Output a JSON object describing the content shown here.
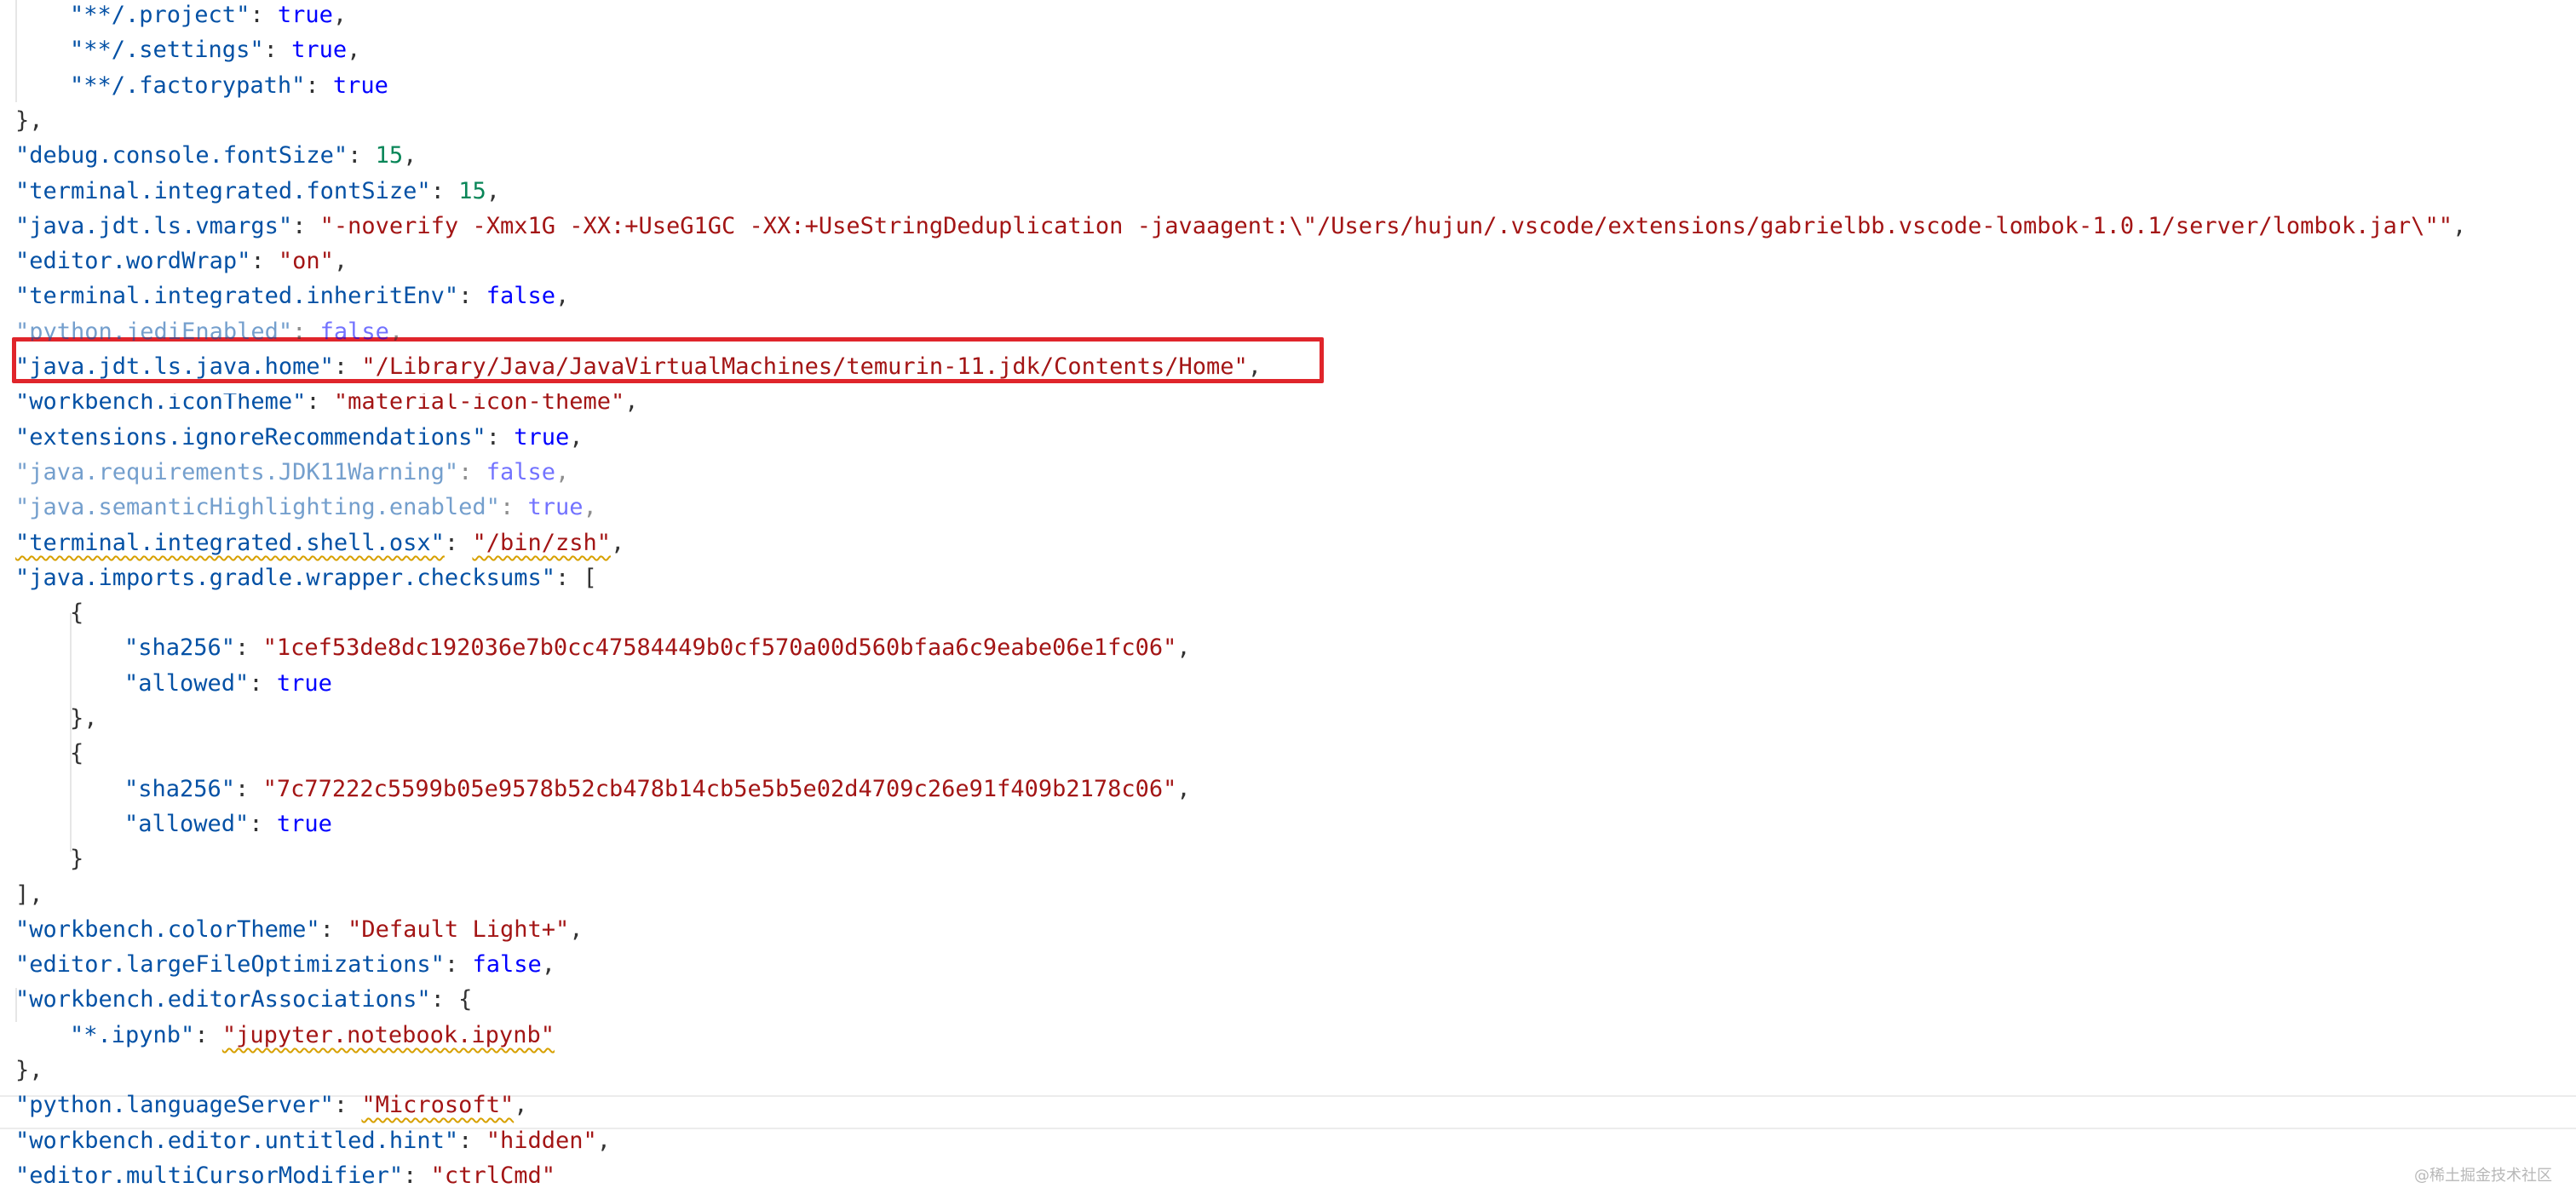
{
  "lines": [
    {
      "parts": [
        {
          "t": "\"**/.project\"",
          "c": "key"
        },
        {
          "t": ": ",
          "c": "punc"
        },
        {
          "t": "true",
          "c": "bool"
        },
        {
          "t": ",",
          "c": "punc"
        }
      ]
    },
    {
      "parts": [
        {
          "t": "\"**/.settings\"",
          "c": "key"
        },
        {
          "t": ": ",
          "c": "punc"
        },
        {
          "t": "true",
          "c": "bool"
        },
        {
          "t": ",",
          "c": "punc"
        }
      ]
    },
    {
      "parts": [
        {
          "t": "\"**/.factorypath\"",
          "c": "key"
        },
        {
          "t": ": ",
          "c": "punc"
        },
        {
          "t": "true",
          "c": "bool"
        }
      ]
    },
    {
      "parts": [
        {
          "t": "},",
          "c": "punc"
        }
      ]
    },
    {
      "parts": [
        {
          "t": "\"debug.console.fontSize\"",
          "c": "key"
        },
        {
          "t": ": ",
          "c": "punc"
        },
        {
          "t": "15",
          "c": "num"
        },
        {
          "t": ",",
          "c": "punc"
        }
      ]
    },
    {
      "parts": [
        {
          "t": "\"terminal.integrated.fontSize\"",
          "c": "key"
        },
        {
          "t": ": ",
          "c": "punc"
        },
        {
          "t": "15",
          "c": "num"
        },
        {
          "t": ",",
          "c": "punc"
        }
      ]
    },
    {
      "parts": [
        {
          "t": "\"java.jdt.ls.vmargs\"",
          "c": "key"
        },
        {
          "t": ": ",
          "c": "punc"
        },
        {
          "t": "\"-noverify -Xmx1G -XX:+UseG1GC -XX:+UseStringDeduplication -javaagent:\\\"/Users/hujun/.vscode/extensions/gabrielbb.vscode-lombok-1.0.1/server/lombok.jar\\\"\"",
          "c": "str"
        },
        {
          "t": ",",
          "c": "punc"
        }
      ]
    },
    {
      "parts": [
        {
          "t": "\"editor.wordWrap\"",
          "c": "key"
        },
        {
          "t": ": ",
          "c": "punc"
        },
        {
          "t": "\"on\"",
          "c": "str"
        },
        {
          "t": ",",
          "c": "punc"
        }
      ]
    },
    {
      "parts": [
        {
          "t": "\"terminal.integrated.inheritEnv\"",
          "c": "key"
        },
        {
          "t": ": ",
          "c": "punc"
        },
        {
          "t": "false",
          "c": "bool"
        },
        {
          "t": ",",
          "c": "punc"
        }
      ]
    },
    {
      "parts": [
        {
          "t": "\"python.jediEnabled\"",
          "c": "key"
        },
        {
          "t": ": ",
          "c": "punc"
        },
        {
          "t": "false",
          "c": "bool"
        },
        {
          "t": ",",
          "c": "punc"
        }
      ]
    },
    {
      "parts": [
        {
          "t": "\"java.jdt.ls.java.home\"",
          "c": "key"
        },
        {
          "t": ": ",
          "c": "punc"
        },
        {
          "t": "\"/Library/Java/JavaVirtualMachines/temurin-11.jdk/Contents/Home\"",
          "c": "str"
        },
        {
          "t": ",",
          "c": "punc"
        }
      ]
    },
    {
      "parts": [
        {
          "t": "\"workbench.iconTheme\"",
          "c": "key"
        },
        {
          "t": ": ",
          "c": "punc"
        },
        {
          "t": "\"material-icon-theme\"",
          "c": "str"
        },
        {
          "t": ",",
          "c": "punc"
        }
      ]
    },
    {
      "parts": [
        {
          "t": "\"extensions.ignoreRecommendations\"",
          "c": "key"
        },
        {
          "t": ": ",
          "c": "punc"
        },
        {
          "t": "true",
          "c": "bool"
        },
        {
          "t": ",",
          "c": "punc"
        }
      ]
    },
    {
      "parts": [
        {
          "t": "\"java.requirements.JDK11Warning\"",
          "c": "key"
        },
        {
          "t": ": ",
          "c": "punc"
        },
        {
          "t": "false",
          "c": "bool"
        },
        {
          "t": ",",
          "c": "punc"
        }
      ]
    },
    {
      "parts": [
        {
          "t": "\"java.semanticHighlighting.enabled\"",
          "c": "key"
        },
        {
          "t": ": ",
          "c": "punc"
        },
        {
          "t": "true",
          "c": "bool"
        },
        {
          "t": ",",
          "c": "punc"
        }
      ]
    },
    {
      "parts": [
        {
          "t": "\"terminal.integrated.shell.osx\"",
          "c": "key"
        },
        {
          "t": ": ",
          "c": "punc"
        },
        {
          "t": "\"/bin/zsh\"",
          "c": "str"
        },
        {
          "t": ",",
          "c": "punc"
        }
      ]
    },
    {
      "parts": [
        {
          "t": "\"java.imports.gradle.wrapper.checksums\"",
          "c": "key"
        },
        {
          "t": ": [",
          "c": "punc"
        }
      ]
    },
    {
      "parts": [
        {
          "t": "{",
          "c": "punc"
        }
      ]
    },
    {
      "parts": [
        {
          "t": "\"sha256\"",
          "c": "key"
        },
        {
          "t": ": ",
          "c": "punc"
        },
        {
          "t": "\"1cef53de8dc192036e7b0cc47584449b0cf570a00d560bfaa6c9eabe06e1fc06\"",
          "c": "str"
        },
        {
          "t": ",",
          "c": "punc"
        }
      ]
    },
    {
      "parts": [
        {
          "t": "\"allowed\"",
          "c": "key"
        },
        {
          "t": ": ",
          "c": "punc"
        },
        {
          "t": "true",
          "c": "bool"
        }
      ]
    },
    {
      "parts": [
        {
          "t": "},",
          "c": "punc"
        }
      ]
    },
    {
      "parts": [
        {
          "t": "{",
          "c": "punc"
        }
      ]
    },
    {
      "parts": [
        {
          "t": "\"sha256\"",
          "c": "key"
        },
        {
          "t": ": ",
          "c": "punc"
        },
        {
          "t": "\"7c77222c5599b05e9578b52cb478b14cb5e5b5e02d4709c26e91f409b2178c06\"",
          "c": "str"
        },
        {
          "t": ",",
          "c": "punc"
        }
      ]
    },
    {
      "parts": [
        {
          "t": "\"allowed\"",
          "c": "key"
        },
        {
          "t": ": ",
          "c": "punc"
        },
        {
          "t": "true",
          "c": "bool"
        }
      ]
    },
    {
      "parts": [
        {
          "t": "}",
          "c": "punc"
        }
      ]
    },
    {
      "parts": [
        {
          "t": "],",
          "c": "punc"
        }
      ]
    },
    {
      "parts": [
        {
          "t": "\"workbench.colorTheme\"",
          "c": "key"
        },
        {
          "t": ": ",
          "c": "punc"
        },
        {
          "t": "\"Default Light+\"",
          "c": "str"
        },
        {
          "t": ",",
          "c": "punc"
        }
      ]
    },
    {
      "parts": [
        {
          "t": "\"editor.largeFileOptimizations\"",
          "c": "key"
        },
        {
          "t": ": ",
          "c": "punc"
        },
        {
          "t": "false",
          "c": "bool"
        },
        {
          "t": ",",
          "c": "punc"
        }
      ]
    },
    {
      "parts": [
        {
          "t": "\"workbench.editorAssociations\"",
          "c": "key"
        },
        {
          "t": ": {",
          "c": "punc"
        }
      ]
    },
    {
      "parts": [
        {
          "t": "\"*.ipynb\"",
          "c": "key"
        },
        {
          "t": ": ",
          "c": "punc"
        },
        {
          "t": "\"jupyter.notebook.ipynb\"",
          "c": "str"
        }
      ]
    },
    {
      "parts": [
        {
          "t": "},",
          "c": "punc"
        }
      ]
    },
    {
      "parts": [
        {
          "t": "\"python.languageServer\"",
          "c": "key"
        },
        {
          "t": ": ",
          "c": "punc"
        },
        {
          "t": "\"Microsoft\"",
          "c": "str"
        },
        {
          "t": ",",
          "c": "punc"
        }
      ]
    },
    {
      "parts": [
        {
          "t": "\"workbench.editor.untitled.hint\"",
          "c": "key"
        },
        {
          "t": ": ",
          "c": "punc"
        },
        {
          "t": "\"hidden\"",
          "c": "str"
        },
        {
          "t": ",",
          "c": "punc"
        }
      ]
    },
    {
      "parts": [
        {
          "t": "\"editor.multiCursorModifier\"",
          "c": "key"
        },
        {
          "t": ": ",
          "c": "punc"
        },
        {
          "t": "\"ctrlCmd\"",
          "c": "str"
        }
      ]
    }
  ],
  "watermark": "@稀土掘金技术社区",
  "colors": {
    "key": "#0451a5",
    "string": "#a31515",
    "number": "#098658",
    "boolean": "#0000ff",
    "highlight_box": "#e0252b"
  }
}
